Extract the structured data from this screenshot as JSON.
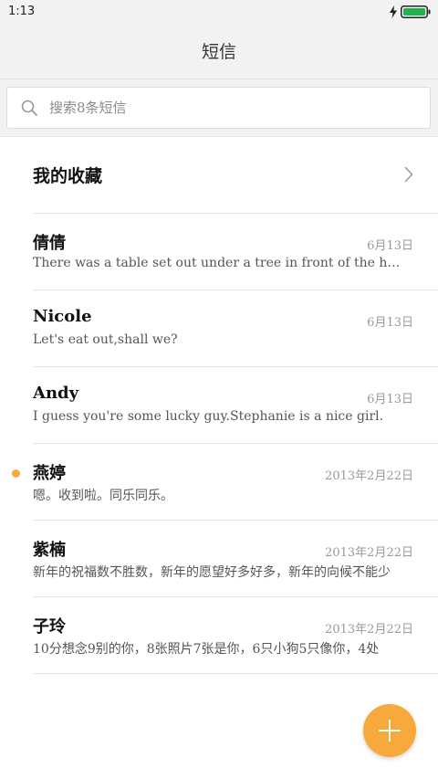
{
  "status_bar": {
    "time": "1:13",
    "icons": [
      "charging-bolt-icon",
      "battery-icon"
    ],
    "battery_color": "#22b14c"
  },
  "header": {
    "title": "短信"
  },
  "search": {
    "placeholder": "搜索8条短信",
    "value": "",
    "icon": "search-icon"
  },
  "favorites": {
    "label": "我的收藏",
    "icon": "chevron-right-icon"
  },
  "messages": [
    {
      "name": "倩倩",
      "date": "6月13日",
      "preview": "There was a table set out under a tree in front of the house",
      "unread": false
    },
    {
      "name": "Nicole",
      "date": "6月13日",
      "preview": "Let's eat out,shall we?",
      "unread": false
    },
    {
      "name": "Andy",
      "date": "6月13日",
      "preview": "I guess you're some lucky guy.Stephanie is a nice girl.",
      "unread": false
    },
    {
      "name": "燕婷",
      "date": "2013年2月22日",
      "preview": "嗯。收到啦。同乐同乐。",
      "unread": true
    },
    {
      "name": "紫楠",
      "date": "2013年2月22日",
      "preview": "新年的祝福数不胜数，新年的愿望好多好多，新年的向候不能少",
      "unread": false
    },
    {
      "name": "子玲",
      "date": "2013年2月22日",
      "preview": "10分想念9别的你，8张照片7张是你，6只小狗5只像你，4处",
      "unread": false
    }
  ],
  "fab": {
    "icon": "plus-icon",
    "color": "#f7a93b"
  }
}
